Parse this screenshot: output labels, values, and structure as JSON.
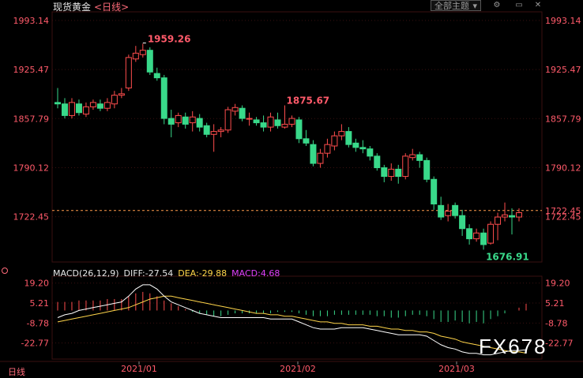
{
  "header": {
    "instrument": "现货黄金",
    "timeframe": "<日线>",
    "theme_button": "全部主题",
    "theme_caret": "▾"
  },
  "toolbar": {
    "tool1_icon": "settings-icon",
    "tool2_icon": "window-icon",
    "tool3_icon": "close-icon"
  },
  "colors": {
    "up": "#ff4d4d",
    "down": "#39d98a",
    "bg": "#000000",
    "grid": "#3a1010",
    "price_line": "#ff9a4a",
    "diff": "#ffffff",
    "dea": "#ffd54a",
    "macd": "#e040fb"
  },
  "price_axis": {
    "labels": [
      "1993.14",
      "1925.47",
      "1857.79",
      "1790.12",
      "1722.45"
    ]
  },
  "macd_axis": {
    "labels": [
      "19.20",
      "5.21",
      "-8.78",
      "-22.77"
    ]
  },
  "date_axis": {
    "labels": [
      "2021/01",
      "2021/02",
      "2021/03"
    ]
  },
  "annotations": {
    "high": "1959.26",
    "mid": "1875.67",
    "low": "1676.91"
  },
  "macd_legend": {
    "title": "MACD(26,12,9)",
    "diff": "DIFF:-27.54",
    "dea": "DEA:-29.88",
    "macd": "MACD:4.68"
  },
  "period_label": "日线",
  "watermark": "FX678",
  "chart_data": {
    "type": "candlestick",
    "ylim": [
      1660,
      2005
    ],
    "current_price": 1731,
    "candles": [
      [
        1880,
        1878,
        1900,
        1872
      ],
      [
        1878,
        1862,
        1886,
        1858
      ],
      [
        1862,
        1880,
        1886,
        1858
      ],
      [
        1878,
        1866,
        1884,
        1862
      ],
      [
        1864,
        1874,
        1880,
        1860
      ],
      [
        1874,
        1880,
        1884,
        1870
      ],
      [
        1878,
        1872,
        1884,
        1868
      ],
      [
        1872,
        1880,
        1886,
        1868
      ],
      [
        1878,
        1890,
        1896,
        1872
      ],
      [
        1890,
        1892,
        1900,
        1886
      ],
      [
        1900,
        1942,
        1946,
        1896
      ],
      [
        1940,
        1948,
        1958,
        1936
      ],
      [
        1946,
        1952,
        1961,
        1942
      ],
      [
        1952,
        1922,
        1956,
        1918
      ],
      [
        1920,
        1914,
        1928,
        1910
      ],
      [
        1914,
        1858,
        1918,
        1850
      ],
      [
        1858,
        1850,
        1870,
        1832
      ],
      [
        1852,
        1862,
        1866,
        1846
      ],
      [
        1860,
        1850,
        1866,
        1844
      ],
      [
        1852,
        1860,
        1868,
        1840
      ],
      [
        1858,
        1846,
        1864,
        1840
      ],
      [
        1848,
        1836,
        1852,
        1832
      ],
      [
        1836,
        1840,
        1850,
        1812
      ],
      [
        1840,
        1842,
        1846,
        1832
      ],
      [
        1842,
        1870,
        1874,
        1838
      ],
      [
        1868,
        1873,
        1878,
        1862
      ],
      [
        1872,
        1858,
        1876,
        1854
      ],
      [
        1858,
        1858,
        1866,
        1848
      ],
      [
        1856,
        1852,
        1860,
        1848
      ],
      [
        1852,
        1846,
        1862,
        1840
      ],
      [
        1846,
        1860,
        1866,
        1840
      ],
      [
        1856,
        1848,
        1866,
        1844
      ],
      [
        1846,
        1850,
        1876,
        1844
      ],
      [
        1850,
        1858,
        1862,
        1846
      ],
      [
        1856,
        1830,
        1860,
        1824
      ],
      [
        1830,
        1824,
        1842,
        1820
      ],
      [
        1822,
        1796,
        1828,
        1792
      ],
      [
        1796,
        1810,
        1816,
        1790
      ],
      [
        1810,
        1822,
        1830,
        1804
      ],
      [
        1820,
        1834,
        1840,
        1814
      ],
      [
        1834,
        1840,
        1850,
        1828
      ],
      [
        1840,
        1822,
        1846,
        1818
      ],
      [
        1824,
        1818,
        1830,
        1812
      ],
      [
        1818,
        1816,
        1828,
        1810
      ],
      [
        1816,
        1806,
        1820,
        1800
      ],
      [
        1806,
        1790,
        1810,
        1786
      ],
      [
        1790,
        1778,
        1794,
        1770
      ],
      [
        1778,
        1788,
        1796,
        1772
      ],
      [
        1788,
        1778,
        1794,
        1768
      ],
      [
        1778,
        1806,
        1810,
        1774
      ],
      [
        1804,
        1808,
        1816,
        1800
      ],
      [
        1808,
        1800,
        1812,
        1790
      ],
      [
        1800,
        1774,
        1804,
        1770
      ],
      [
        1774,
        1740,
        1778,
        1732
      ],
      [
        1738,
        1722,
        1750,
        1718
      ],
      [
        1724,
        1730,
        1740,
        1716
      ],
      [
        1738,
        1724,
        1742,
        1720
      ],
      [
        1724,
        1706,
        1732,
        1696
      ],
      [
        1706,
        1692,
        1712,
        1684
      ],
      [
        1692,
        1700,
        1706,
        1688
      ],
      [
        1700,
        1684,
        1706,
        1677
      ],
      [
        1686,
        1712,
        1716,
        1684
      ],
      [
        1712,
        1722,
        1728,
        1690
      ],
      [
        1722,
        1725,
        1742,
        1716
      ],
      [
        1724,
        1722,
        1734,
        1698
      ],
      [
        1722,
        1728,
        1734,
        1716
      ]
    ],
    "macd": {
      "ylim": [
        -34,
        24
      ],
      "hist": [
        6,
        6,
        6,
        7,
        7,
        7,
        7,
        8,
        8,
        8,
        10,
        12,
        13,
        12,
        10,
        7,
        5,
        3,
        1,
        -1,
        -2,
        -3,
        -4,
        -4,
        -3,
        -2,
        -2,
        -2,
        -2,
        -2,
        -2,
        -1,
        -1,
        -1,
        -2,
        -3,
        -4,
        -4,
        -4,
        -3,
        -3,
        -3,
        -3,
        -3,
        -3,
        -4,
        -4,
        -5,
        -5,
        -4,
        -3,
        -3,
        -4,
        -6,
        -8,
        -8,
        -7,
        -8,
        -9,
        -8,
        -9,
        -6,
        -4,
        -2,
        0,
        2,
        4.68
      ],
      "diff": [
        -5,
        -3,
        -2,
        0,
        1,
        2,
        3,
        4,
        5,
        6,
        10,
        15,
        18,
        18,
        15,
        10,
        6,
        4,
        2,
        0,
        -2,
        -3,
        -4,
        -5,
        -5,
        -5,
        -5,
        -5,
        -5,
        -5,
        -6,
        -6,
        -6,
        -6,
        -8,
        -10,
        -12,
        -13,
        -13,
        -13,
        -12,
        -12,
        -12,
        -12,
        -13,
        -14,
        -15,
        -16,
        -17,
        -17,
        -17,
        -17,
        -18,
        -21,
        -24,
        -26,
        -27,
        -29,
        -30,
        -30,
        -31,
        -31,
        -30,
        -29,
        -28,
        -28,
        -27.54
      ],
      "dea": [
        -8,
        -7,
        -6,
        -5,
        -4,
        -3,
        -2,
        -1,
        0,
        1,
        2,
        4,
        6,
        8,
        9,
        10,
        10,
        9,
        8,
        7,
        6,
        5,
        4,
        3,
        2,
        1,
        0,
        -1,
        -2,
        -2,
        -3,
        -3,
        -4,
        -4,
        -5,
        -6,
        -7,
        -8,
        -8,
        -9,
        -9,
        -10,
        -10,
        -10,
        -11,
        -11,
        -12,
        -13,
        -13,
        -14,
        -14,
        -15,
        -15,
        -16,
        -18,
        -19,
        -20,
        -22,
        -23,
        -24,
        -25,
        -26,
        -27,
        -28,
        -29,
        -29,
        -29.88
      ]
    }
  }
}
